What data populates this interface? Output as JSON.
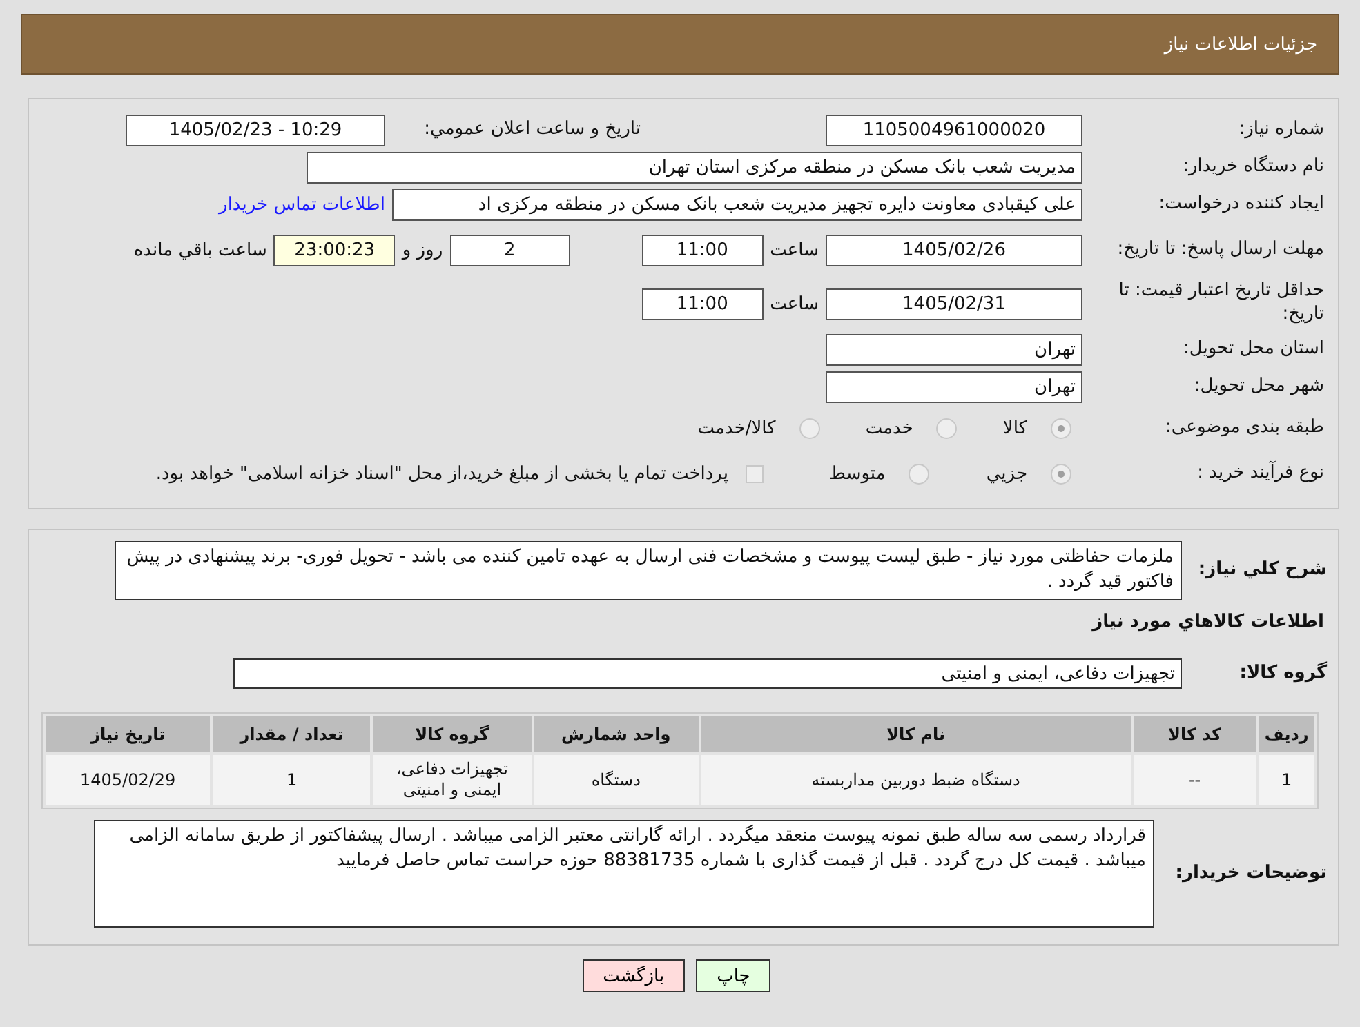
{
  "header": {
    "title": "جزئیات اطلاعات نیاز"
  },
  "general": {
    "need_number": {
      "label": "شماره نیاز:",
      "value": "1105004961000020"
    },
    "announce": {
      "label": "تاریخ و ساعت اعلان عمومي:",
      "value": "1405/02/23 - 10:29"
    },
    "buyer_org": {
      "label": "نام دستگاه خریدار:",
      "value": "مدیریت شعب بانک مسکن در منطقه مرکزی استان تهران"
    },
    "requester": {
      "label": "ایجاد کننده درخواست:",
      "value": "علی کیقبادی معاونت دایره تجهیز مدیریت شعب بانک مسکن در منطقه مرکزی اد",
      "link": "اطلاعات تماس خریدار"
    },
    "deadline": {
      "label": "مهلت ارسال پاسخ: تا تاریخ:",
      "date": "1405/02/26",
      "time_label": "ساعت",
      "time": "11:00",
      "days": "2",
      "days_label": "روز و",
      "remaining": "23:00:23",
      "remaining_label": "ساعت باقي مانده"
    },
    "price_validity": {
      "label": "حداقل تاریخ اعتبار قیمت: تا تاریخ:",
      "date": "1405/02/31",
      "time_label": "ساعت",
      "time": "11:00"
    },
    "province": {
      "label": "استان محل تحویل:",
      "value": "تهران"
    },
    "city": {
      "label": "شهر محل تحویل:",
      "value": "تهران"
    },
    "category": {
      "label": "طبقه بندی موضوعی:",
      "options": [
        {
          "label": "کالا",
          "selected": true
        },
        {
          "label": "خدمت",
          "selected": false
        },
        {
          "label": "کالا/خدمت",
          "selected": false
        }
      ]
    },
    "process": {
      "label": "نوع فرآیند خرید :",
      "options": [
        {
          "label": "جزيي",
          "selected": true
        },
        {
          "label": "متوسط",
          "selected": false
        }
      ],
      "treasury": {
        "label": "پرداخت تمام یا بخشی از مبلغ خرید،از محل \"اسناد خزانه اسلامی\" خواهد بود.",
        "checked": false
      }
    }
  },
  "details": {
    "description": {
      "label": "شرح کلي نیاز:",
      "value": "ملزمات حفاظتی مورد نیاز - طبق لیست پیوست و مشخصات فنی  ارسال به عهده تامین کننده می باشد - تحویل فوری- برند پیشنهادی در پیش فاکتور قید گردد ."
    },
    "goods_title": "اطلاعات کالاهاي مورد نیاز",
    "goods_group": {
      "label": "گروه کالا:",
      "value": "تجهیزات دفاعی، ایمنی و امنیتی"
    },
    "table": {
      "columns": [
        "ردیف",
        "کد کالا",
        "نام کالا",
        "واحد شمارش",
        "گروه کالا",
        "تعداد / مقدار",
        "تاریخ نیاز"
      ],
      "rows": [
        [
          "1",
          "--",
          "دستگاه ضبط دوربین مداربسته",
          "دستگاه",
          "تجهیزات دفاعی، ایمنی و امنیتی",
          "1",
          "1405/02/29"
        ]
      ]
    },
    "buyer_notes": {
      "label": "توضیحات خریدار:",
      "value": "قرارداد رسمی  سه ساله طبق نمونه پیوست منعقد میگردد . ارائه گارانتی معتبر الزامی میباشد . ارسال پیشفاکتور از طریق سامانه الزامی میباشد . قیمت کل درج گردد . قبل از قیمت گذاری با شماره 88381735 حوزه حراست تماس حاصل فرمایید"
    }
  },
  "buttons": [
    {
      "label": "چاپ",
      "kind": "print"
    },
    {
      "label": "بازگشت",
      "kind": "back"
    }
  ]
}
